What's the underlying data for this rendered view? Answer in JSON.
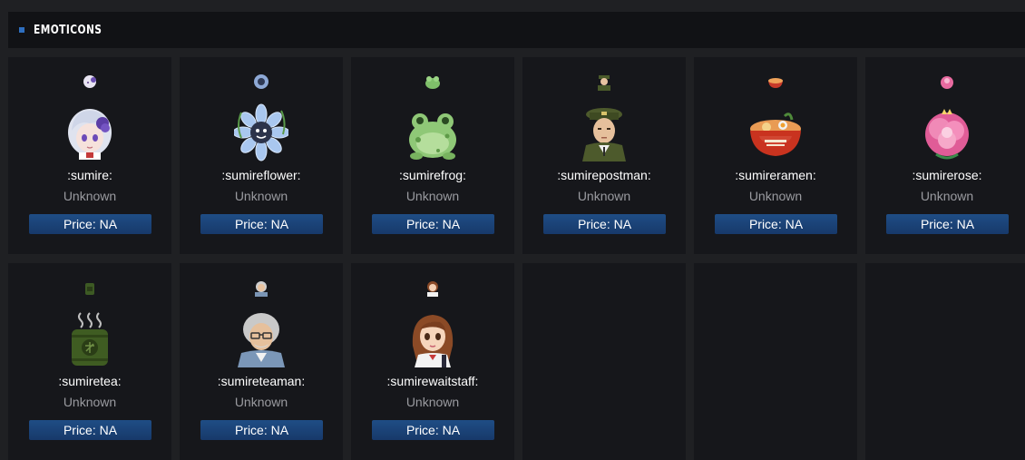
{
  "section": {
    "title": "EMOTICONS",
    "accent_color": "#2e6fc0"
  },
  "emotes": [
    {
      "name": ":sumire:",
      "subtitle": "Unknown",
      "price_label": "Price: NA",
      "icon": "sumire-icon"
    },
    {
      "name": ":sumireflower:",
      "subtitle": "Unknown",
      "price_label": "Price: NA",
      "icon": "sumireflower-icon"
    },
    {
      "name": ":sumirefrog:",
      "subtitle": "Unknown",
      "price_label": "Price: NA",
      "icon": "sumirefrog-icon"
    },
    {
      "name": ":sumirepostman:",
      "subtitle": "Unknown",
      "price_label": "Price: NA",
      "icon": "sumirepostman-icon"
    },
    {
      "name": ":sumireramen:",
      "subtitle": "Unknown",
      "price_label": "Price: NA",
      "icon": "sumireramen-icon"
    },
    {
      "name": ":sumirerose:",
      "subtitle": "Unknown",
      "price_label": "Price: NA",
      "icon": "sumirerose-icon"
    },
    {
      "name": ":sumiretea:",
      "subtitle": "Unknown",
      "price_label": "Price: NA",
      "icon": "sumiretea-icon"
    },
    {
      "name": ":sumireteaman:",
      "subtitle": "Unknown",
      "price_label": "Price: NA",
      "icon": "sumireteaman-icon"
    },
    {
      "name": ":sumirewaitstaff:",
      "subtitle": "Unknown",
      "price_label": "Price: NA",
      "icon": "sumirewaitstaff-icon"
    }
  ]
}
